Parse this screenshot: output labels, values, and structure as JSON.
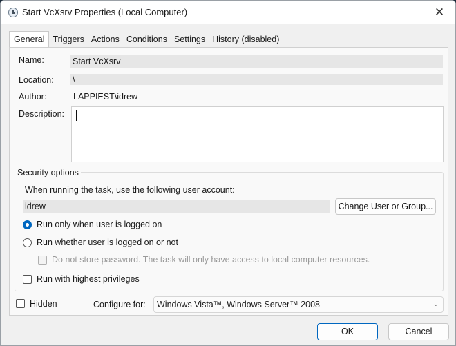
{
  "window": {
    "title": "Start VcXsrv Properties (Local Computer)",
    "close_glyph": "✕"
  },
  "tabs": [
    "General",
    "Triggers",
    "Actions",
    "Conditions",
    "Settings",
    "History (disabled)"
  ],
  "active_tab": "General",
  "general": {
    "name_label": "Name:",
    "name_value": "Start VcXsrv",
    "location_label": "Location:",
    "location_value": "\\",
    "author_label": "Author:",
    "author_value": "LAPPIEST\\idrew",
    "description_label": "Description:",
    "description_value": ""
  },
  "security": {
    "group_title": "Security options",
    "account_prompt": "When running the task, use the following user account:",
    "account_value": "idrew",
    "change_button": "Change User or Group...",
    "radio_logged_on": "Run only when user is logged on",
    "radio_logged_on_selected": true,
    "radio_whether": "Run whether user is logged on or not",
    "radio_whether_selected": false,
    "no_store_password": "Do not store password.  The task will only have access to local computer resources.",
    "no_store_password_checked": false,
    "highest_privileges": "Run with highest privileges",
    "highest_privileges_checked": false
  },
  "footer_options": {
    "hidden_label": "Hidden",
    "hidden_checked": false,
    "configure_label": "Configure for:",
    "configure_value": "Windows Vista™, Windows Server™ 2008"
  },
  "buttons": {
    "ok": "OK",
    "cancel": "Cancel"
  },
  "colors": {
    "accent": "#0067c0",
    "focus_underline": "#2f6fbf",
    "ok_border": "#0067c0"
  },
  "icons": {
    "title": "clock-task-icon",
    "close": "close-icon",
    "dropdown": "chevron-down-icon"
  }
}
